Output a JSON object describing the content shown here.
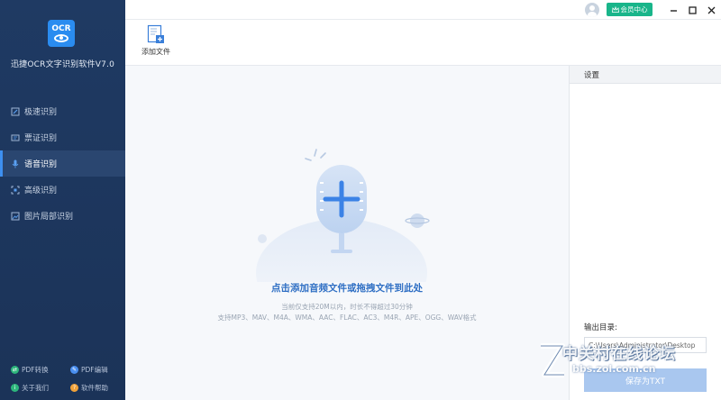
{
  "app": {
    "logo_text": "OCR",
    "title": "迅捷OCR文字识别软件V7.0"
  },
  "sidebar": {
    "items": [
      {
        "label": "极速识别",
        "icon": "scan-doc-icon",
        "active": false
      },
      {
        "label": "票证识别",
        "icon": "ticket-icon",
        "active": false
      },
      {
        "label": "语音识别",
        "icon": "microphone-icon",
        "active": true
      },
      {
        "label": "高级识别",
        "icon": "advanced-scan-icon",
        "active": false
      },
      {
        "label": "图片局部识别",
        "icon": "image-crop-icon",
        "active": false
      }
    ],
    "bottom_links": [
      {
        "label": "PDF转换",
        "icon": "pdf-convert-icon",
        "color": "#2db67c"
      },
      {
        "label": "PDF编辑",
        "icon": "pdf-edit-icon",
        "color": "#4a8ff0"
      },
      {
        "label": "关于我们",
        "icon": "about-icon",
        "color": "#2db67c"
      },
      {
        "label": "软件帮助",
        "icon": "help-icon",
        "color": "#f0a23a"
      }
    ]
  },
  "titlebar": {
    "vip_label": "会员中心",
    "accent": "#19b58a"
  },
  "toolbar": {
    "add_file_label": "添加文件"
  },
  "dropzone": {
    "title": "点击添加音频文件或拖拽文件到此处",
    "hint_line1": "当前仅支持20M以内，时长不得超过30分钟",
    "hint_line2": "支持MP3、MAV、M4A、WMA、AAC、FLAC、AC3、M4R、APE、OGG、WAV格式"
  },
  "settings": {
    "header": "设置",
    "output_label": "输出目录:",
    "output_path": "C:\\Users\\Administrator\\Desktop",
    "save_label": "保存为TXT"
  },
  "watermark": {
    "text": "中关村在线论坛",
    "url": "bbs.zol.com.cn"
  }
}
